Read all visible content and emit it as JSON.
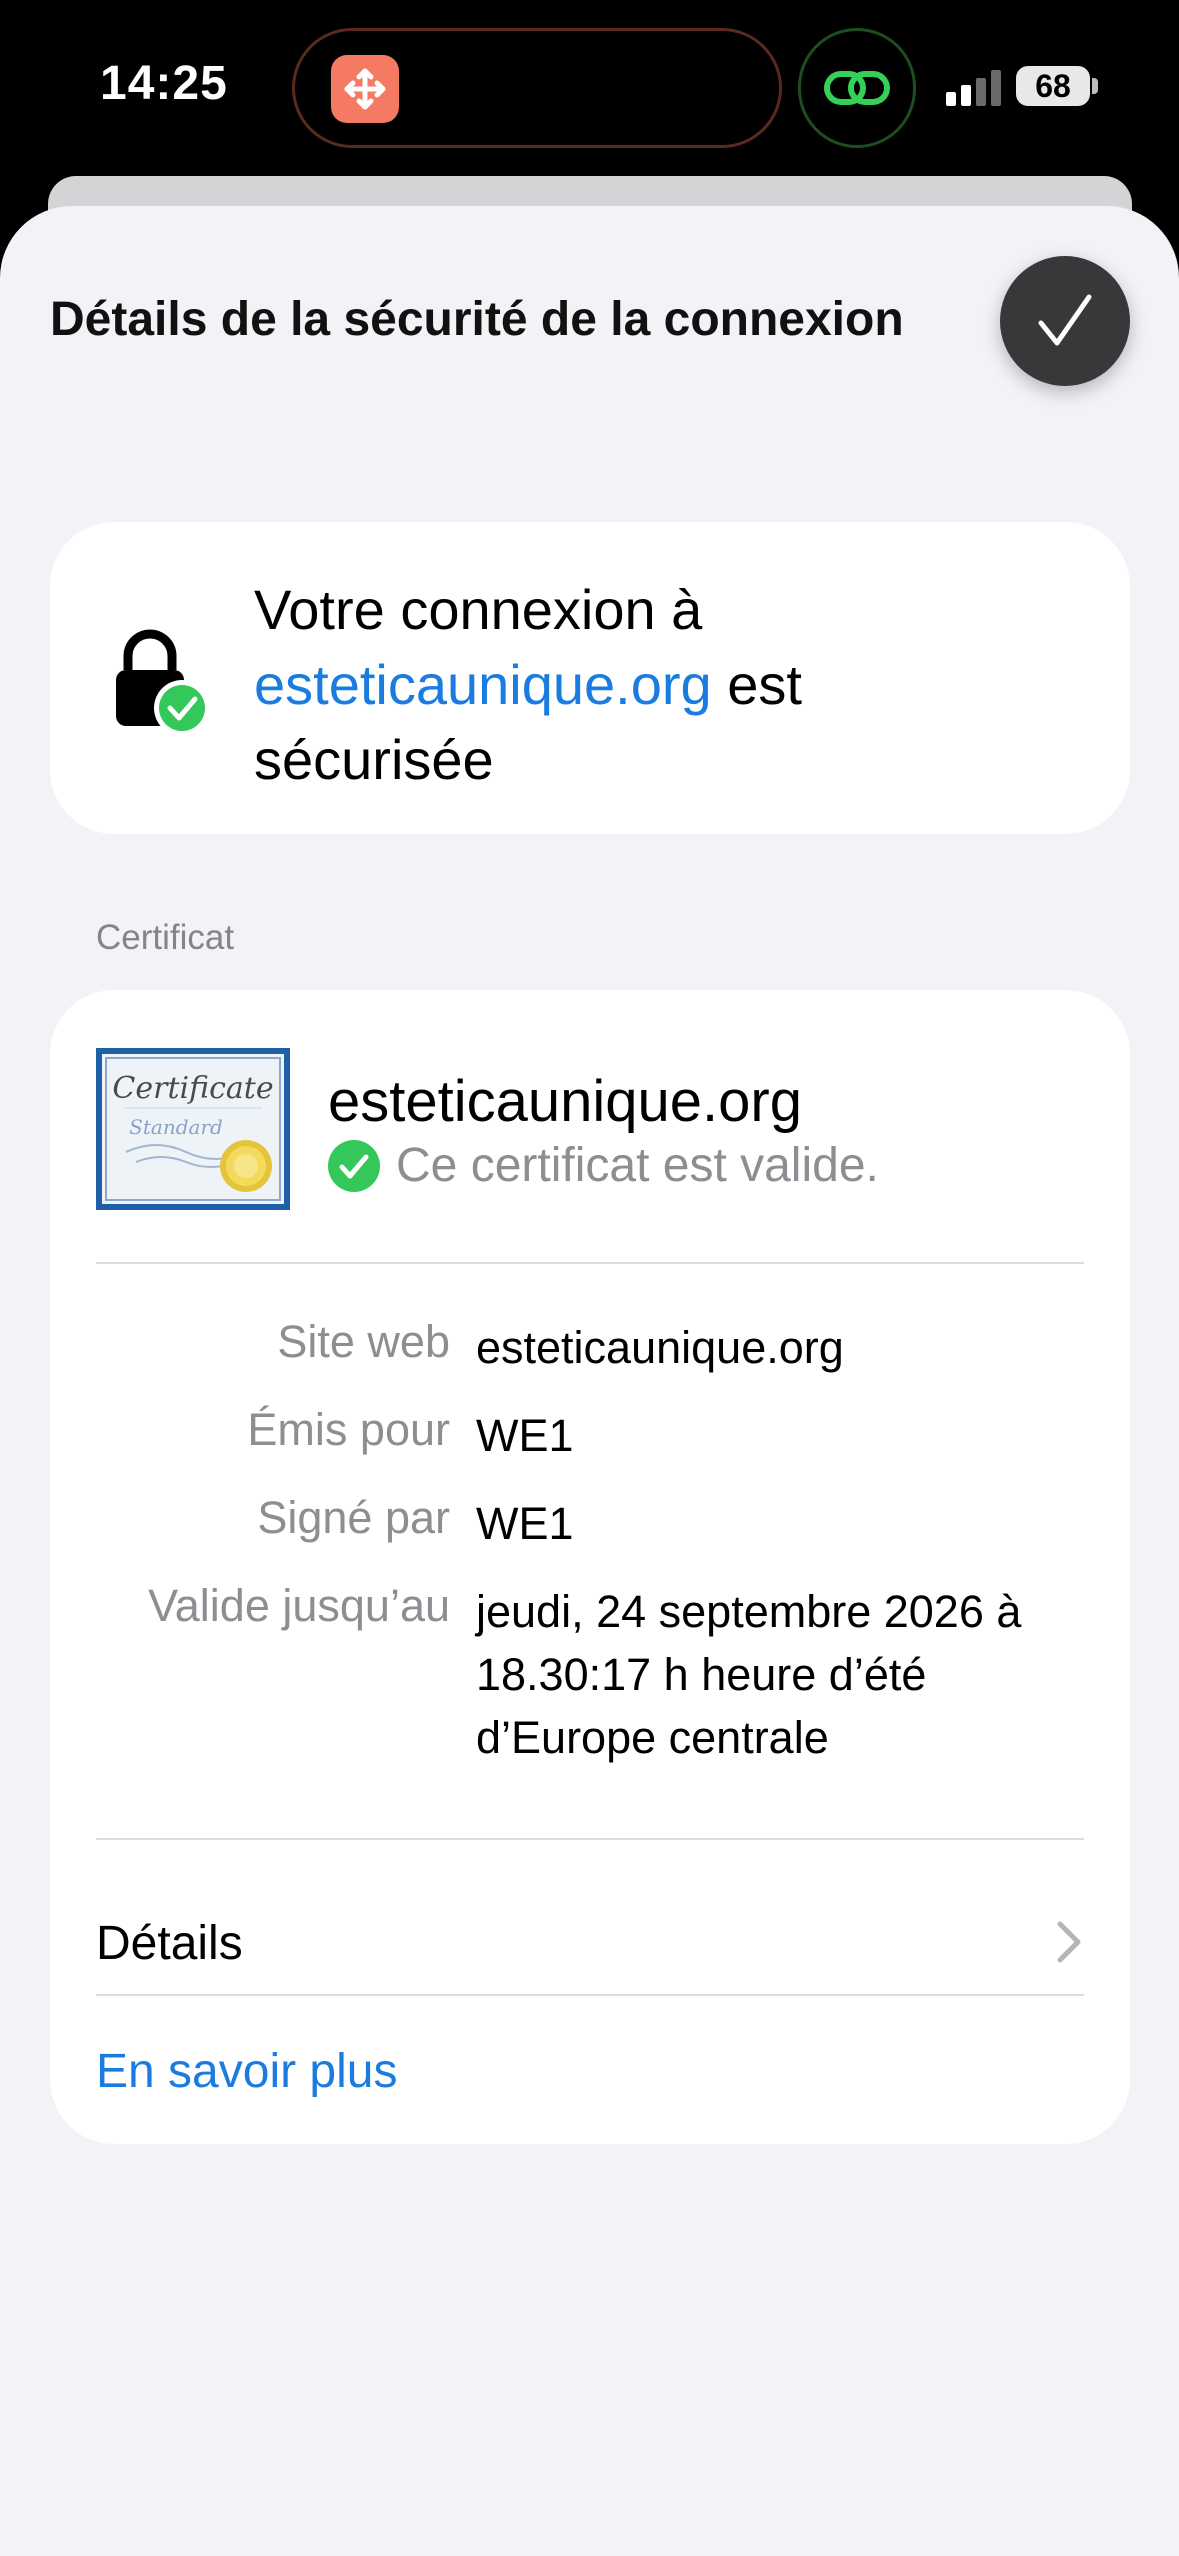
{
  "status_bar": {
    "time": "14:25",
    "battery": "68"
  },
  "sheet": {
    "title": "Détails de la sécurité de la connexion",
    "done_icon": "checkmark-icon"
  },
  "secure_card": {
    "text_prefix": "Votre connexion à",
    "domain": "esteticaunique.org",
    "text_suffix": "est",
    "text_end": "sécurisée",
    "lock_icon": "lock-check-icon"
  },
  "certificate": {
    "section_label": "Certificat",
    "image_icon": "certificate-standard-image",
    "domain": "esteticaunique.org",
    "status": "Ce certificat est valide.",
    "rows": [
      {
        "label": "Site web",
        "value": "esteticaunique.org"
      },
      {
        "label": "Émis pour",
        "value": "WE1"
      },
      {
        "label": "Signé par",
        "value": "WE1"
      },
      {
        "label": "Valide jusqu’au",
        "value": "jeudi, 24 septembre 2026 à 18.30:17 h heure d’été d’Europe centrale"
      }
    ],
    "details_label": "Détails",
    "learn_more": "En savoir plus"
  },
  "colors": {
    "accent": "#1a7ce0",
    "success": "#34c759",
    "sheet_bg": "#f2f2f7",
    "done_button": "#38383b"
  }
}
